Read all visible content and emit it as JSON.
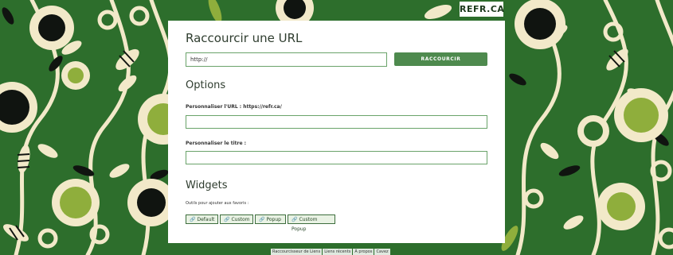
{
  "brand": {
    "logo": "REFR.CA"
  },
  "shorten": {
    "title": "Raccourcir une URL",
    "input_value": "http://",
    "button_label": "RACCOURCIR"
  },
  "options": {
    "title": "Options",
    "custom_url_label": "Personnaliser l'URL : https://refr.ca/",
    "custom_url_value": "",
    "custom_title_label": "Personnaliser le titre :",
    "custom_title_value": ""
  },
  "widgets": {
    "title": "Widgets",
    "description": "Outils pour ajouter aux favoris :",
    "buttons": [
      {
        "label": "Default",
        "icon": "link-icon"
      },
      {
        "label": "Custom",
        "icon": "link-icon"
      },
      {
        "label": "Popup",
        "icon": "link-icon"
      },
      {
        "label": "Custom Popup",
        "icon": "link-icon"
      }
    ]
  },
  "footer": {
    "links": [
      "Raccourcisseur de Liens",
      "Liens récents",
      "À propos",
      "Cavez"
    ]
  },
  "colors": {
    "background_green": "#2d6e2c",
    "accent_green": "#4e8a4e",
    "field_border": "#6aa36a",
    "cream": "#f2e9c9",
    "lime": "#8fae3c"
  }
}
